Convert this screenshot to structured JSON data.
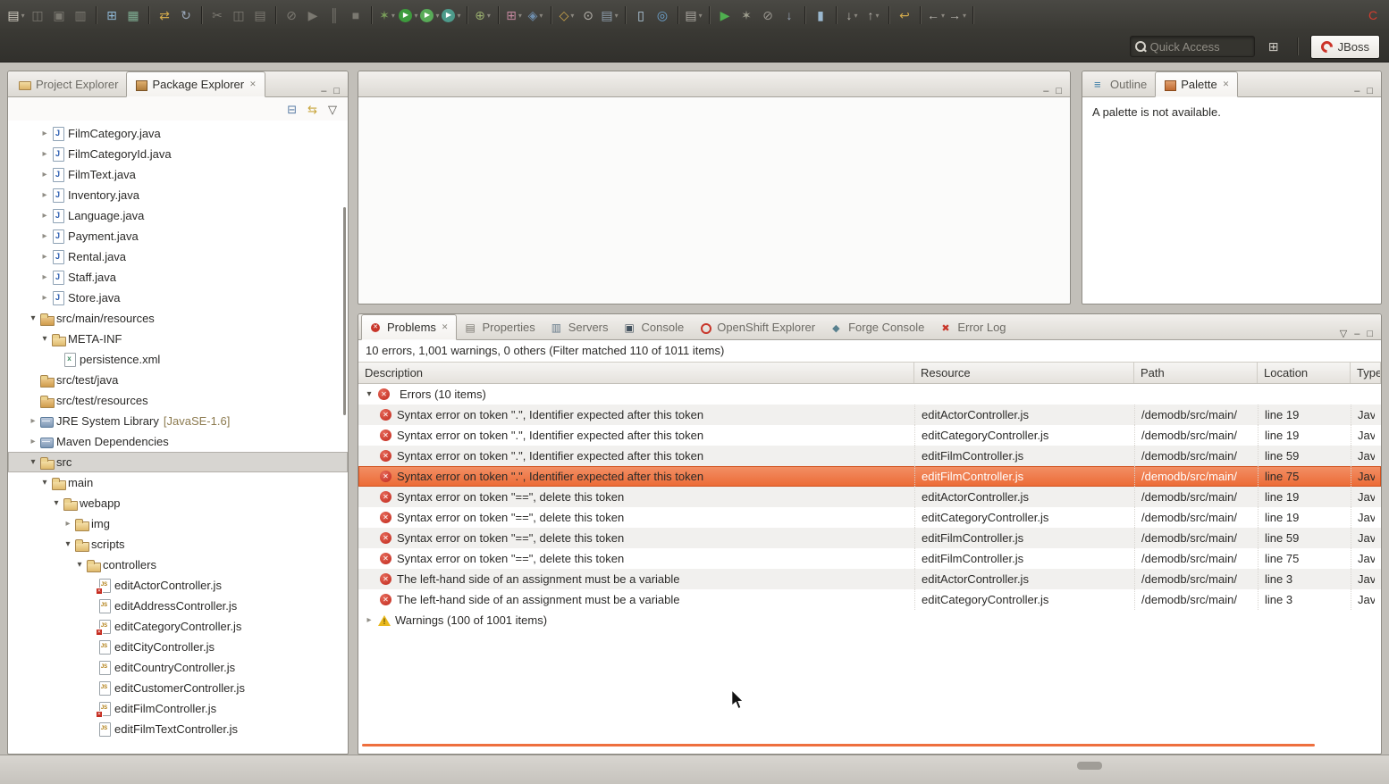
{
  "chrome_icons": {
    "minimize": "–",
    "maximize": "□",
    "view_menu": "▽",
    "collapse_all": "⊟",
    "link_with_editor": "⇆",
    "close": "✕",
    "open_perspective": "⊞",
    "expanded_arrow": "▾",
    "collapsed_arrow": "▸"
  },
  "quick_access": {
    "placeholder": "Quick Access"
  },
  "perspective": {
    "label": "JBoss"
  },
  "toolbar": {
    "groups": [
      [
        {
          "name": "new",
          "glyph": "▤",
          "color": "#d9d5c9",
          "dropdown": true
        },
        {
          "name": "save",
          "glyph": "◫",
          "color": "#c9c5b9",
          "disabled": true
        },
        {
          "name": "save-all",
          "glyph": "▣",
          "color": "#c9c5b9",
          "disabled": true
        },
        {
          "name": "print",
          "glyph": "▥",
          "color": "#c9c5b9",
          "disabled": true
        }
      ],
      [
        {
          "name": "new-java-project",
          "glyph": "⊞",
          "color": "#8fb7d4"
        },
        {
          "name": "new-server",
          "glyph": "▦",
          "color": "#7fae93"
        }
      ],
      [
        {
          "name": "sync",
          "glyph": "⇄",
          "color": "#cfa84c"
        },
        {
          "name": "publish",
          "glyph": "↻",
          "color": "#9aa7b8"
        }
      ],
      [
        {
          "name": "cut",
          "glyph": "✂",
          "color": "#c9c5b9",
          "disabled": true
        },
        {
          "name": "copy",
          "glyph": "◫",
          "color": "#c9c5b9",
          "disabled": true
        },
        {
          "name": "paste",
          "glyph": "▤",
          "color": "#c9c5b9",
          "disabled": true
        }
      ],
      [
        {
          "name": "skip-breakpoints",
          "glyph": "⊘",
          "color": "#c9c5b9",
          "disabled": true
        },
        {
          "name": "resume",
          "glyph": "▶",
          "color": "#c9c5b9",
          "disabled": true
        },
        {
          "name": "suspend",
          "glyph": "║",
          "color": "#c9c5b9",
          "disabled": true
        },
        {
          "name": "terminate",
          "glyph": "■",
          "color": "#c9c5b9",
          "disabled": true
        }
      ],
      [
        {
          "name": "debug",
          "glyph": "✶",
          "color": "#7aa05a",
          "dropdown": true
        },
        {
          "name": "run",
          "glyph": "▶",
          "color": "#ffffff",
          "bg": "#3d9b3d",
          "round": true,
          "dropdown": true
        },
        {
          "name": "run-last",
          "glyph": "▶",
          "color": "#ffffff",
          "bg": "#58ab58",
          "round": true,
          "dropdown": true
        },
        {
          "name": "profile",
          "glyph": "▶",
          "color": "#ffffff",
          "bg": "#4d9b8b",
          "round": true,
          "dropdown": true
        }
      ],
      [
        {
          "name": "coverage",
          "glyph": "⊕",
          "color": "#9aaf6f",
          "dropdown": true
        }
      ],
      [
        {
          "name": "new-web-project",
          "glyph": "⊞",
          "color": "#c4889f",
          "dropdown": true
        },
        {
          "name": "new-ee-component",
          "glyph": "◈",
          "color": "#6f8fae",
          "dropdown": true
        }
      ],
      [
        {
          "name": "open-type",
          "glyph": "◇",
          "color": "#cfa84c",
          "dropdown": true
        },
        {
          "name": "search-type",
          "glyph": "⊙",
          "color": "#b8b5ae"
        },
        {
          "name": "javadoc-wizard",
          "glyph": "▤",
          "color": "#8f9fae",
          "dropdown": true
        }
      ],
      [
        {
          "name": "browsersim",
          "glyph": "▯",
          "color": "#b8d4e8"
        },
        {
          "name": "web-browser",
          "glyph": "◎",
          "color": "#6fa7d4"
        }
      ],
      [
        {
          "name": "snippets",
          "glyph": "▤",
          "color": "#aeaba4",
          "dropdown": true
        }
      ],
      [
        {
          "name": "run-on-server",
          "glyph": "▶",
          "color": "#4faf4f"
        },
        {
          "name": "ant-build",
          "glyph": "✶",
          "color": "#9f9f8f"
        },
        {
          "name": "stop-server",
          "glyph": "⊘",
          "color": "#9a9790"
        },
        {
          "name": "import-fetch",
          "glyph": "↓",
          "color": "#9aa7b8"
        }
      ],
      [
        {
          "name": "terminal",
          "glyph": "▮",
          "color": "#9ab8cf"
        }
      ],
      [
        {
          "name": "next-annotation",
          "glyph": "↓",
          "color": "#b8b5ae",
          "dropdown": true
        },
        {
          "name": "prev-annotation",
          "glyph": "↑",
          "color": "#b8b5ae",
          "dropdown": true
        }
      ],
      [
        {
          "name": "last-edit-location",
          "glyph": "↩",
          "color": "#cfa84c"
        }
      ],
      [
        {
          "name": "back",
          "glyph": "←",
          "color": "#b8b5ae",
          "dropdown": true
        },
        {
          "name": "forward",
          "glyph": "→",
          "color": "#b8b5ae",
          "dropdown": true
        }
      ],
      [
        {
          "name": "jboss-central",
          "glyph": "C",
          "color": "#d43d2e"
        }
      ]
    ]
  },
  "left_panel": {
    "tabs": [
      {
        "label": "Project Explorer",
        "icon": "project-explorer",
        "active": false,
        "closable": false
      },
      {
        "label": "Package Explorer",
        "icon": "package-explorer",
        "active": true,
        "closable": true
      }
    ],
    "tree": [
      {
        "label": "FilmCategory.java",
        "level": 2,
        "icon": "java-class",
        "arrow": "collapsed"
      },
      {
        "label": "FilmCategoryId.java",
        "level": 2,
        "icon": "java-class",
        "arrow": "collapsed"
      },
      {
        "label": "FilmText.java",
        "level": 2,
        "icon": "java-class",
        "arrow": "collapsed"
      },
      {
        "label": "Inventory.java",
        "level": 2,
        "icon": "java-class",
        "arrow": "collapsed"
      },
      {
        "label": "Language.java",
        "level": 2,
        "icon": "java-class",
        "arrow": "collapsed"
      },
      {
        "label": "Payment.java",
        "level": 2,
        "icon": "java-class",
        "arrow": "collapsed"
      },
      {
        "label": "Rental.java",
        "level": 2,
        "icon": "java-class",
        "arrow": "collapsed"
      },
      {
        "label": "Staff.java",
        "level": 2,
        "icon": "java-class",
        "arrow": "collapsed"
      },
      {
        "label": "Store.java",
        "level": 2,
        "icon": "java-class",
        "arrow": "collapsed"
      },
      {
        "label": "src/main/resources",
        "level": 1,
        "icon": "source-folder",
        "arrow": "expanded"
      },
      {
        "label": "META-INF",
        "level": 2,
        "icon": "folder",
        "arrow": "expanded"
      },
      {
        "label": "persistence.xml",
        "level": 3,
        "icon": "xml-file",
        "arrow": "none"
      },
      {
        "label": "src/test/java",
        "level": 1,
        "icon": "source-folder",
        "arrow": "none"
      },
      {
        "label": "src/test/resources",
        "level": 1,
        "icon": "source-folder",
        "arrow": "none"
      },
      {
        "label": "JRE System Library",
        "suffix": "[JavaSE-1.6]",
        "level": 1,
        "icon": "library",
        "arrow": "collapsed"
      },
      {
        "label": "Maven Dependencies",
        "level": 1,
        "icon": "library",
        "arrow": "collapsed"
      },
      {
        "label": "src",
        "level": 1,
        "icon": "folder",
        "arrow": "expanded",
        "selected": true
      },
      {
        "label": "main",
        "level": 2,
        "icon": "folder",
        "arrow": "expanded"
      },
      {
        "label": "webapp",
        "level": 3,
        "icon": "folder",
        "arrow": "expanded"
      },
      {
        "label": "img",
        "level": 4,
        "icon": "folder",
        "arrow": "collapsed"
      },
      {
        "label": "scripts",
        "level": 4,
        "icon": "folder",
        "arrow": "expanded"
      },
      {
        "label": "controllers",
        "level": 5,
        "icon": "folder",
        "arrow": "expanded"
      },
      {
        "label": "editActorController.js",
        "level": 6,
        "icon": "js-file",
        "arrow": "none",
        "error": true
      },
      {
        "label": "editAddressController.js",
        "level": 6,
        "icon": "js-file",
        "arrow": "none"
      },
      {
        "label": "editCategoryController.js",
        "level": 6,
        "icon": "js-file",
        "arrow": "none",
        "error": true
      },
      {
        "label": "editCityController.js",
        "level": 6,
        "icon": "js-file",
        "arrow": "none"
      },
      {
        "label": "editCountryController.js",
        "level": 6,
        "icon": "js-file",
        "arrow": "none"
      },
      {
        "label": "editCustomerController.js",
        "level": 6,
        "icon": "js-file",
        "arrow": "none"
      },
      {
        "label": "editFilmController.js",
        "level": 6,
        "icon": "js-file",
        "arrow": "none",
        "error": true
      },
      {
        "label": "editFilmTextController.js",
        "level": 6,
        "icon": "js-file",
        "arrow": "none"
      }
    ]
  },
  "right_panel": {
    "tabs": [
      {
        "label": "Outline",
        "icon": "outline",
        "active": false,
        "closable": false
      },
      {
        "label": "Palette",
        "icon": "palette",
        "active": true,
        "closable": true
      }
    ],
    "message": "A palette is not available."
  },
  "problems": {
    "tabs": [
      {
        "label": "Problems",
        "icon": "problems",
        "active": true,
        "closable": true
      },
      {
        "label": "Properties",
        "icon": "properties"
      },
      {
        "label": "Servers",
        "icon": "servers"
      },
      {
        "label": "Console",
        "icon": "console"
      },
      {
        "label": "OpenShift Explorer",
        "icon": "openshift"
      },
      {
        "label": "Forge Console",
        "icon": "forge"
      },
      {
        "label": "Error Log",
        "icon": "errorlog"
      }
    ],
    "summary": "10 errors, 1,001 warnings, 0 others (Filter matched 110 of 1011 items)",
    "columns": [
      "Description",
      "Resource",
      "Path",
      "Location",
      "Type"
    ],
    "errors_group_label": "Errors (10 items)",
    "warnings_group_label": "Warnings (100 of 1001 items)",
    "selected_index": 3,
    "rows": [
      {
        "description": "Syntax error on token \".\", Identifier expected after this token",
        "resource": "editActorController.js",
        "path": "/demodb/src/main/",
        "location": "line 19",
        "type": "Jav"
      },
      {
        "description": "Syntax error on token \".\", Identifier expected after this token",
        "resource": "editCategoryController.js",
        "path": "/demodb/src/main/",
        "location": "line 19",
        "type": "Jav"
      },
      {
        "description": "Syntax error on token \".\", Identifier expected after this token",
        "resource": "editFilmController.js",
        "path": "/demodb/src/main/",
        "location": "line 59",
        "type": "Jav"
      },
      {
        "description": "Syntax error on token \".\", Identifier expected after this token",
        "resource": "editFilmController.js",
        "path": "/demodb/src/main/",
        "location": "line 75",
        "type": "Jav"
      },
      {
        "description": "Syntax error on token \"==\", delete this token",
        "resource": "editActorController.js",
        "path": "/demodb/src/main/",
        "location": "line 19",
        "type": "Jav"
      },
      {
        "description": "Syntax error on token \"==\", delete this token",
        "resource": "editCategoryController.js",
        "path": "/demodb/src/main/",
        "location": "line 19",
        "type": "Jav"
      },
      {
        "description": "Syntax error on token \"==\", delete this token",
        "resource": "editFilmController.js",
        "path": "/demodb/src/main/",
        "location": "line 59",
        "type": "Jav"
      },
      {
        "description": "Syntax error on token \"==\", delete this token",
        "resource": "editFilmController.js",
        "path": "/demodb/src/main/",
        "location": "line 75",
        "type": "Jav"
      },
      {
        "description": "The left-hand side of an assignment must be a variable",
        "resource": "editActorController.js",
        "path": "/demodb/src/main/",
        "location": "line 3",
        "type": "Jav"
      },
      {
        "description": "The left-hand side of an assignment must be a variable",
        "resource": "editCategoryController.js",
        "path": "/demodb/src/main/",
        "location": "line 3",
        "type": "Jav"
      }
    ]
  }
}
